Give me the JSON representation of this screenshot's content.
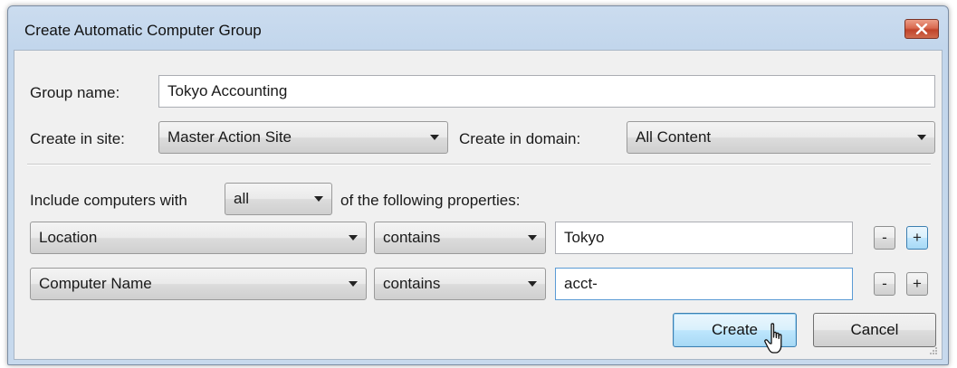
{
  "window": {
    "title": "Create Automatic Computer Group",
    "close_icon": "close-x-icon"
  },
  "form": {
    "group_name_label": "Group name:",
    "group_name_value": "Tokyo Accounting",
    "create_in_site_label": "Create in site:",
    "create_in_site_value": "Master Action Site",
    "create_in_domain_label": "Create in domain:",
    "create_in_domain_value": "All Content"
  },
  "criteria": {
    "include_prefix": "Include computers with",
    "match_value": "all",
    "include_suffix": "of the following properties:",
    "rows": [
      {
        "property": "Location",
        "operator": "contains",
        "value": "Tokyo",
        "remove_label": "-",
        "add_label": "+"
      },
      {
        "property": "Computer Name",
        "operator": "contains",
        "value": "acct-",
        "remove_label": "-",
        "add_label": "+"
      }
    ]
  },
  "buttons": {
    "create": "Create",
    "cancel": "Cancel"
  },
  "colors": {
    "close_button": "#d0593e",
    "default_button_border": "#3c7fb1",
    "dialog_background": "#f0f0f0"
  }
}
